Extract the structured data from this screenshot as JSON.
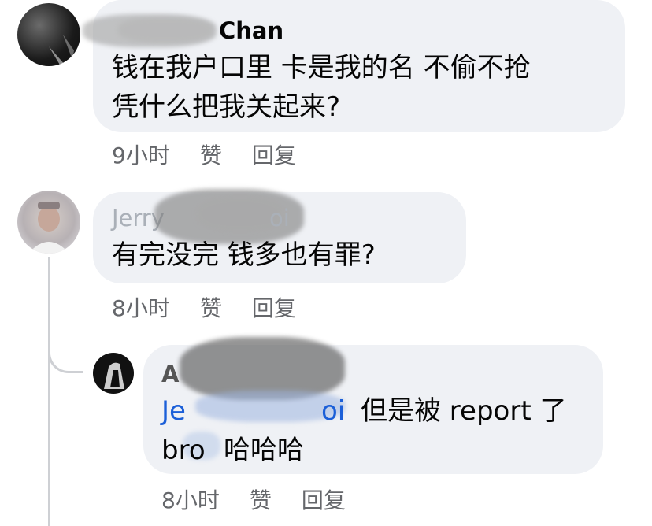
{
  "comments": [
    {
      "author_visible": "Chan",
      "text_line1": "钱在我户口里 卡是我的名 不偷不抢",
      "text_line2": "凭什么把我关起来?",
      "time": "9小时",
      "like_label": "赞",
      "reply_label": "回复"
    },
    {
      "author_visible": "Jerry",
      "author_tail": "oi",
      "text_line1": "有完没完  钱多也有罪?",
      "time": "8小时",
      "like_label": "赞",
      "reply_label": "回复"
    },
    {
      "author_visible": "A",
      "mention_start": "Je",
      "mention_end": "oi",
      "text_after_mention": "但是被 report 了",
      "text_line2_start": "bro",
      "text_line2_end": "哈哈哈",
      "time": "8小时",
      "like_label": "赞",
      "reply_label": "回复"
    }
  ],
  "colors": {
    "bubble": "#eff1f5",
    "meta": "#65676b",
    "mention": "#1b5fd8",
    "thread": "#ced0d4"
  }
}
